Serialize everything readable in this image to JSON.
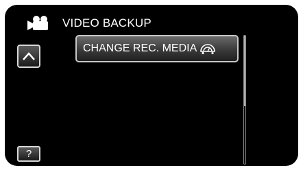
{
  "header": {
    "title": "VIDEO BACKUP",
    "icon": "video-camera-icon"
  },
  "nav": {
    "up_icon": "chevron-up-icon"
  },
  "menu": {
    "items": [
      {
        "label": "CHANGE REC. MEDIA",
        "icon": "recording-media-icon"
      }
    ]
  },
  "scrollbar": {
    "thumb_fraction": 0.55,
    "position_fraction": 0.0
  },
  "help": {
    "label": "?"
  },
  "colors": {
    "background": "#000000",
    "text": "#ffffff",
    "button_border": "#d8d8d8"
  }
}
